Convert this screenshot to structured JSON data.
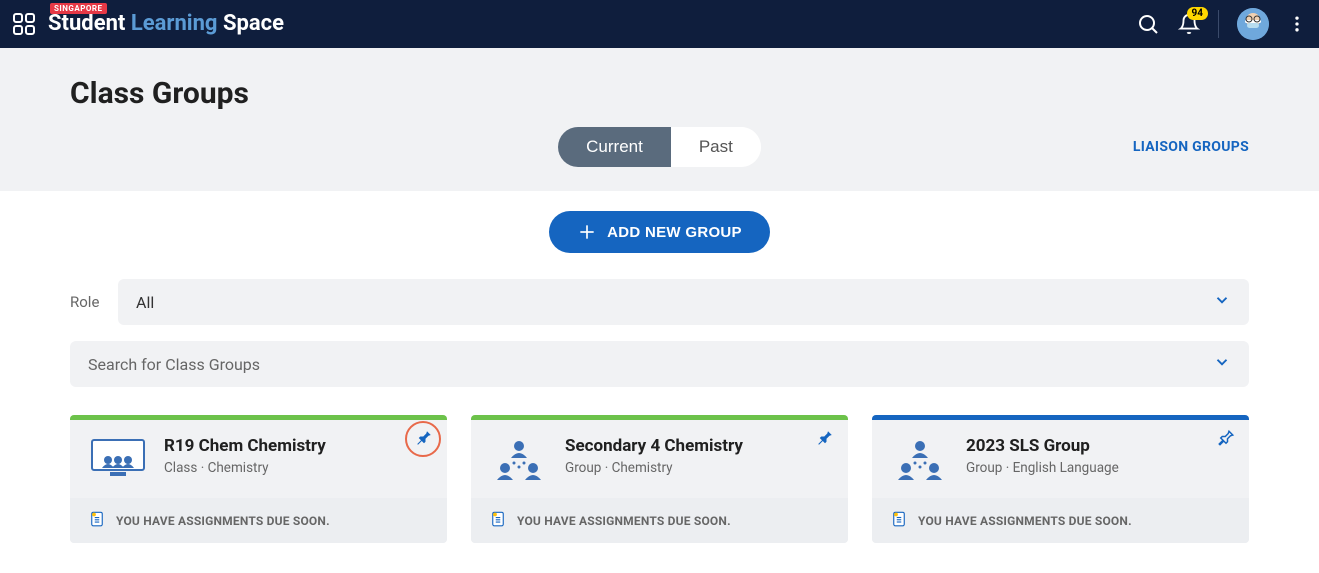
{
  "header": {
    "badge": "SINGAPORE",
    "logo_student": "Student",
    "logo_learning": " Learning ",
    "logo_space": "Space",
    "notif_count": "94"
  },
  "page": {
    "title": "Class Groups"
  },
  "tabs": {
    "current": "Current",
    "past": "Past",
    "liaison": "LIAISON GROUPS"
  },
  "actions": {
    "add_group": "ADD NEW GROUP"
  },
  "filters": {
    "role_label": "Role",
    "role_value": "All",
    "search_placeholder": "Search for Class Groups"
  },
  "cards": [
    {
      "title": "R19 Chem Chemistry",
      "meta": "Class · Chemistry",
      "footer": "YOU HAVE ASSIGNMENTS DUE SOON.",
      "stripe": "green",
      "icon": "class",
      "pinned": true,
      "highlighted": true
    },
    {
      "title": "Secondary 4 Chemistry",
      "meta": "Group · Chemistry",
      "footer": "YOU HAVE ASSIGNMENTS DUE SOON.",
      "stripe": "green",
      "icon": "group",
      "pinned": true,
      "highlighted": false
    },
    {
      "title": "2023 SLS Group",
      "meta": "Group · English Language",
      "footer": "YOU HAVE ASSIGNMENTS DUE SOON.",
      "stripe": "blue",
      "icon": "group",
      "pinned": false,
      "highlighted": false
    }
  ]
}
